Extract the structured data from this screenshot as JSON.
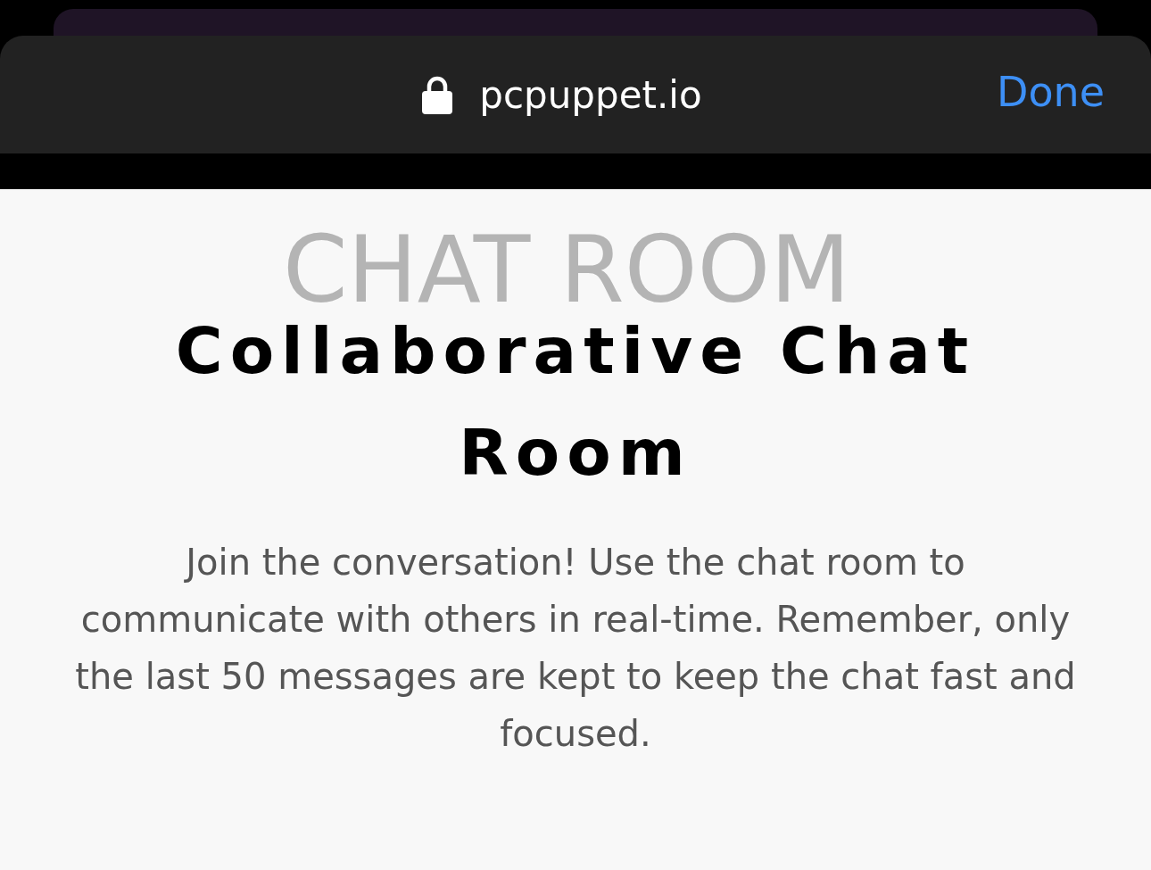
{
  "browser_bar": {
    "address": "pcpuppet.io",
    "done_label": "Done"
  },
  "page": {
    "background_word": "CHAT ROOM",
    "title": "Collaborative Chat Room",
    "description": "Join the conversation! Use the chat room to communicate with others in real-time. Remember, only the last 50 messages are kept to keep the chat fast and focused."
  }
}
